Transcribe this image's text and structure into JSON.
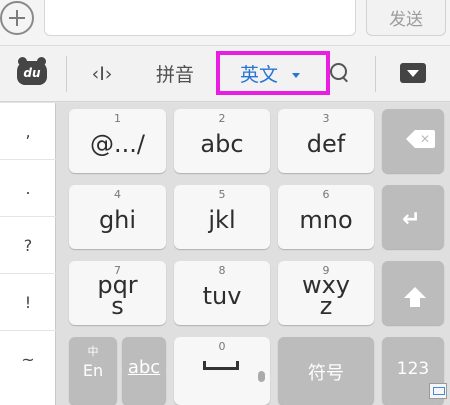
{
  "input_bar": {
    "text_value": "",
    "send_label": "发送"
  },
  "toolbar": {
    "logo_text": "du",
    "cursor_icon": "‹I›",
    "pinyin_label": "拼音",
    "english_label": "英文",
    "highlight_color": "#e81ee0",
    "active_color": "#2874d4"
  },
  "symbols": [
    ",",
    ".",
    "?",
    "!",
    "~"
  ],
  "keys": {
    "k1": {
      "num": "1",
      "label": "@.../"
    },
    "k2": {
      "num": "2",
      "label": "abc"
    },
    "k3": {
      "num": "3",
      "label": "def"
    },
    "k4": {
      "num": "4",
      "label": "ghi"
    },
    "k5": {
      "num": "5",
      "label": "jkl"
    },
    "k6": {
      "num": "6",
      "label": "mno"
    },
    "k7": {
      "num": "7",
      "line1": "pqr",
      "line2": "s"
    },
    "k8": {
      "num": "8",
      "label": "tuv"
    },
    "k9": {
      "num": "9",
      "line1": "wxy",
      "line2": "z"
    },
    "k0": {
      "num": "0"
    }
  },
  "bottom_row": {
    "lang_small": "中",
    "lang_label": "En",
    "abc_label": "abc",
    "symbol_label": "符号",
    "number_label": "123"
  },
  "icons": {
    "delete": "backspace-icon",
    "enter": "enter-icon",
    "shift": "shift-icon",
    "search": "search-icon",
    "collapse": "collapse-keyboard-icon",
    "mic": "microphone-icon"
  }
}
